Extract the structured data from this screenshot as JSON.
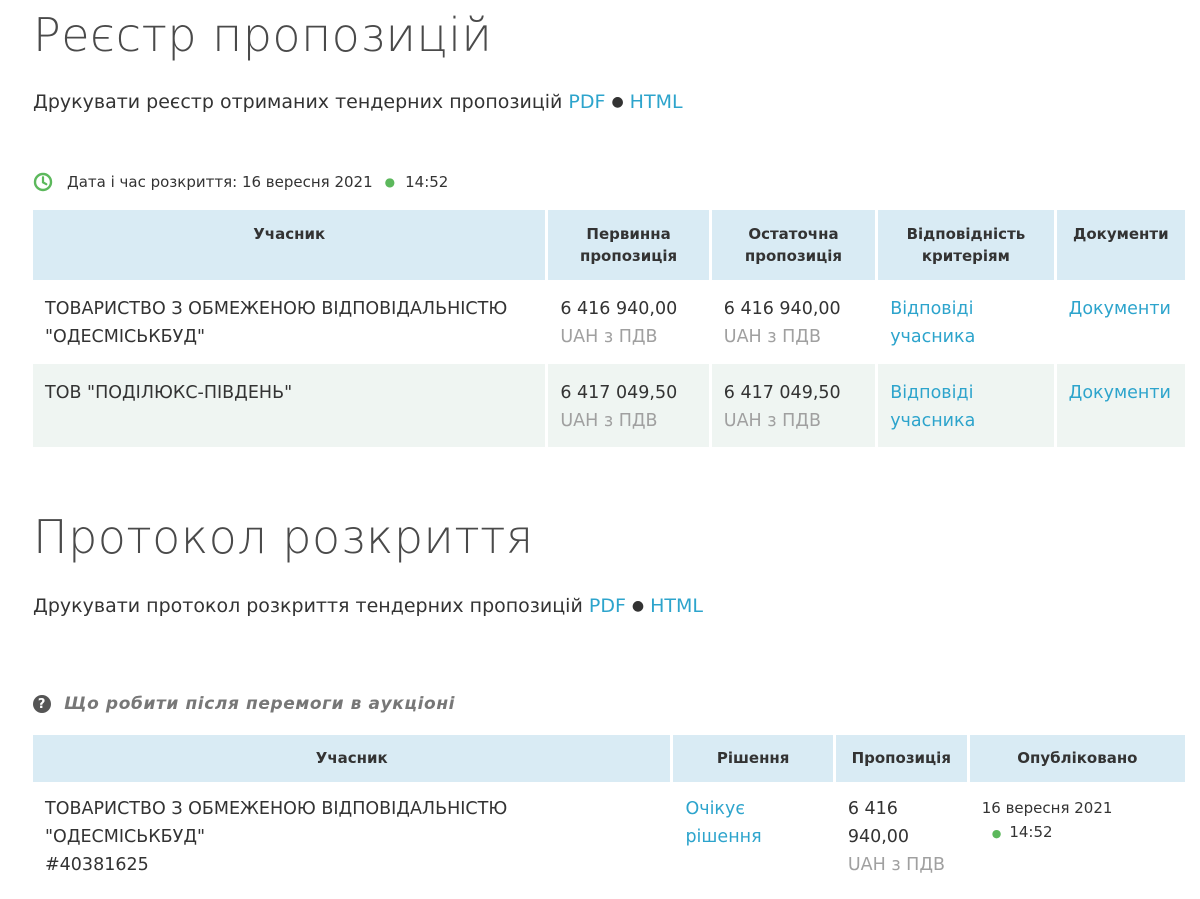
{
  "register": {
    "title": "Реєстр пропозицій",
    "print_text": "Друкувати реєстр отриманих тендерних пропозицій",
    "pdf": "PDF",
    "html": "HTML",
    "opening_label": "Дата і час розкриття: 16 вересня 2021",
    "opening_time": "14:52",
    "headers": {
      "participant": "Учасник",
      "initial": "Первинна пропозиція",
      "final": "Остаточна пропозиція",
      "criteria": "Відповідність критеріям",
      "documents": "Документи"
    },
    "rows": [
      {
        "participant": "ТОВАРИСТВО З ОБМЕЖЕНОЮ ВІДПОВІДАЛЬНІСТЮ \"ОДЕСМІСЬКБУД\"",
        "initial": "6 416 940,00",
        "initial_unit": "UAH з ПДВ",
        "final": "6 416 940,00",
        "final_unit": "UAH з ПДВ",
        "criteria": "Відповіді учасника",
        "documents": "Документи"
      },
      {
        "participant": "ТОВ \"ПОДІЛЮКС-ПІВДЕНЬ\"",
        "initial": "6 417 049,50",
        "initial_unit": "UAH з ПДВ",
        "final": "6 417 049,50",
        "final_unit": "UAH з ПДВ",
        "criteria": "Відповіді учасника",
        "documents": "Документи"
      }
    ]
  },
  "protocol": {
    "title": "Протокол розкриття",
    "print_text": "Друкувати протокол розкриття тендерних пропозицій",
    "pdf": "PDF",
    "html": "HTML",
    "help_text": "Що робити після перемоги в аукціоні",
    "headers": {
      "participant": "Учасник",
      "decision": "Рішення",
      "offer": "Пропозиція",
      "published": "Опубліковано"
    },
    "rows": [
      {
        "participant": "ТОВАРИСТВО З ОБМЕЖЕНОЮ ВІДПОВІДАЛЬНІСТЮ \"ОДЕСМІСЬКБУД\"",
        "code": "#40381625",
        "decision": "Очікує рішення",
        "offer_line1": "6 416",
        "offer_line2": "940,00",
        "offer_unit": "UAH з ПДВ",
        "published_date": "16 вересня 2021",
        "published_time": "14:52"
      }
    ]
  },
  "colors": {
    "accent": "#2da4cc",
    "header_bg": "#d9ebf4",
    "alt_row_bg": "#eff5f2",
    "clock": "#5cb85c"
  },
  "icons": {
    "clock": "clock-icon",
    "help": "question-circle-icon"
  }
}
